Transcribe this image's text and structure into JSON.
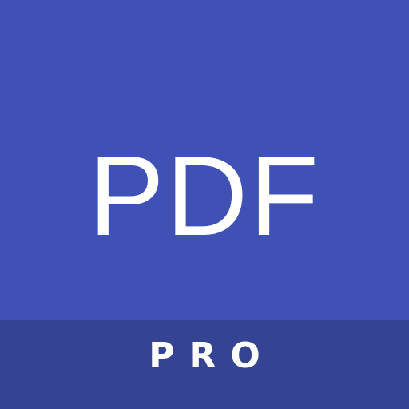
{
  "app_icon": {
    "title": "PDF",
    "badge": "PRO"
  },
  "colors": {
    "background": "#3f51b5",
    "band": "#354393",
    "text": "#ffffff"
  }
}
